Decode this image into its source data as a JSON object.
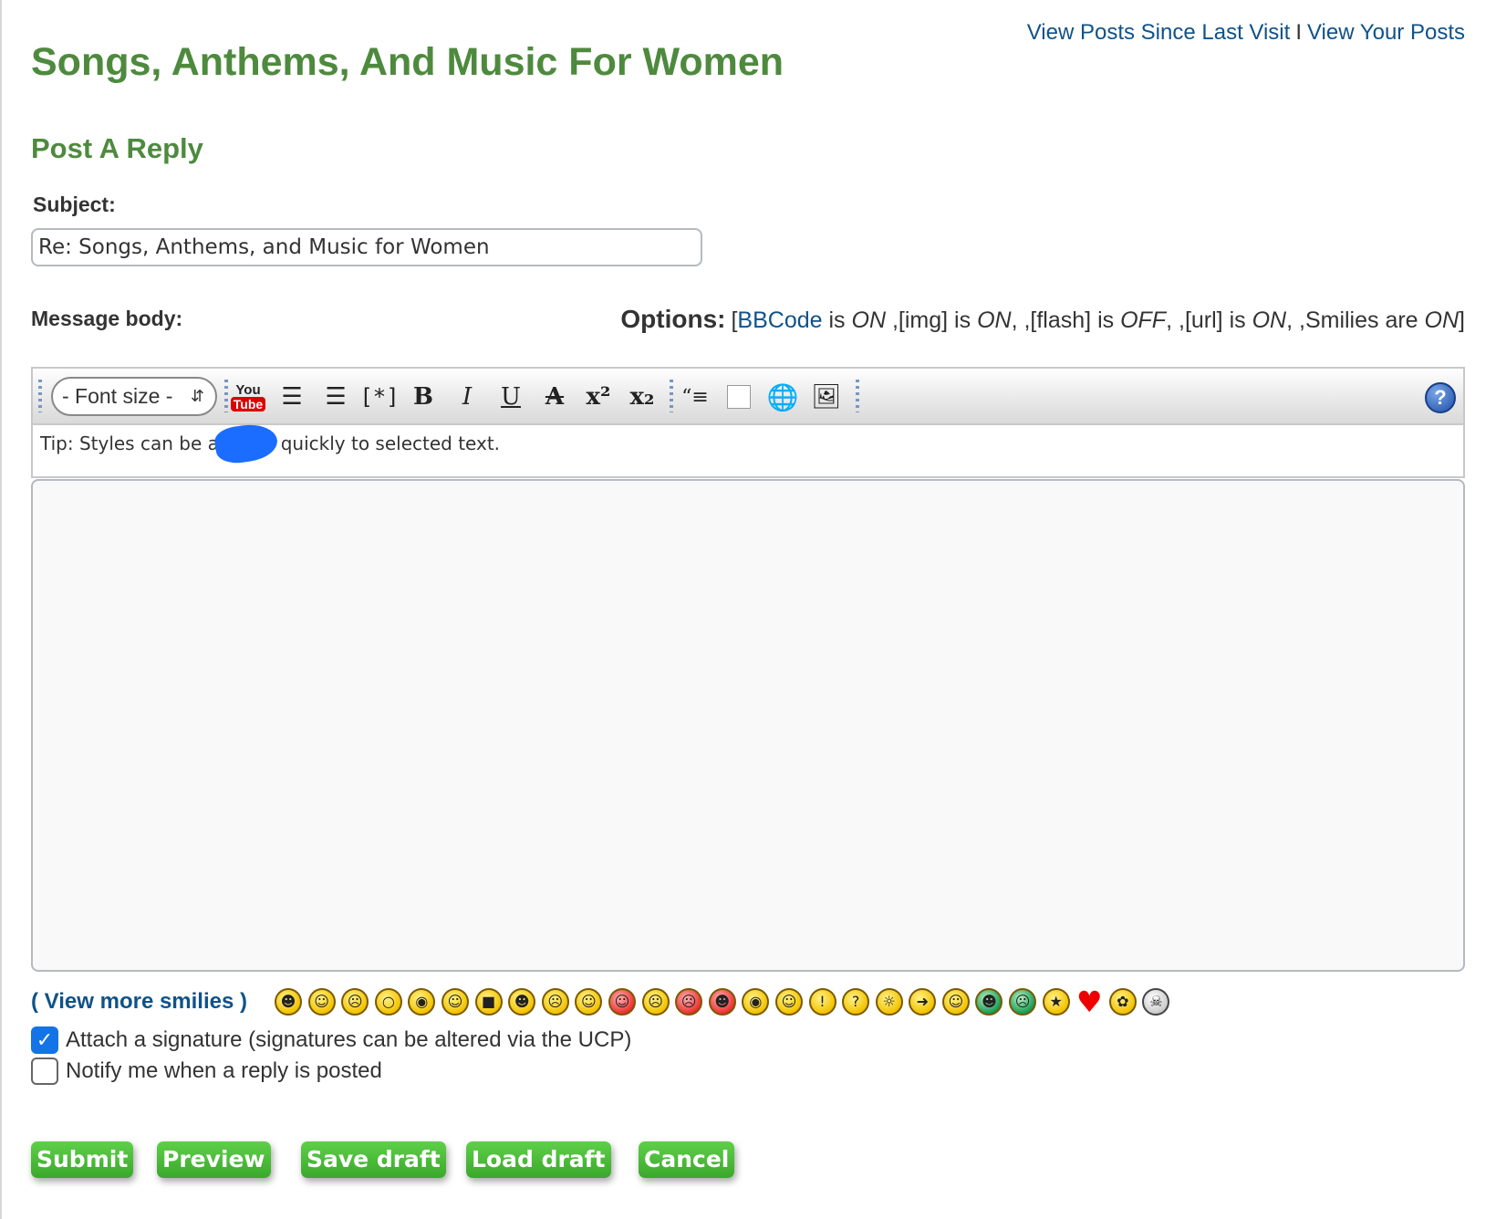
{
  "header": {
    "title": "Songs, Anthems, And Music For Women",
    "links": {
      "view_posts_since": "View Posts Since Last Visit",
      "separator": "I",
      "view_your_posts": "View Your Posts"
    }
  },
  "form": {
    "heading": "Post A Reply",
    "subject_label": "Subject:",
    "subject_value": "Re: Songs, Anthems, and Music for Women",
    "message_label": "Message body:",
    "options": {
      "label": "Options:",
      "open": "[",
      "bbcode_link": "BBCode",
      "is": "is",
      "on": "ON",
      "off": "OFF",
      "img": ",[img]",
      "flash": ",[flash]",
      "url": ",[url]",
      "comma": ",",
      "smilies": ",Smilies are",
      "close": "]"
    },
    "toolbar": {
      "font_size": "- Font size -",
      "youtube_you": "You",
      "youtube_tube": "Tube",
      "help": "?"
    },
    "tip": "Tip: Styles can be applied quickly to selected text.",
    "message_value": ""
  },
  "smilies": {
    "open": "(",
    "link": "View more smilies",
    "close": ")"
  },
  "checkboxes": {
    "signature": {
      "label": "Attach a signature (signatures can be altered via the UCP)",
      "checked": true
    },
    "notify": {
      "label": "Notify me when a reply is posted",
      "checked": false
    }
  },
  "buttons": {
    "submit": "Submit",
    "preview": "Preview",
    "save_draft": "Save draft",
    "load_draft": "Load draft",
    "cancel": "Cancel"
  },
  "colors": {
    "title_green": "#4e8a3e",
    "link_blue": "#105289",
    "button_green": "#3aa82b"
  }
}
